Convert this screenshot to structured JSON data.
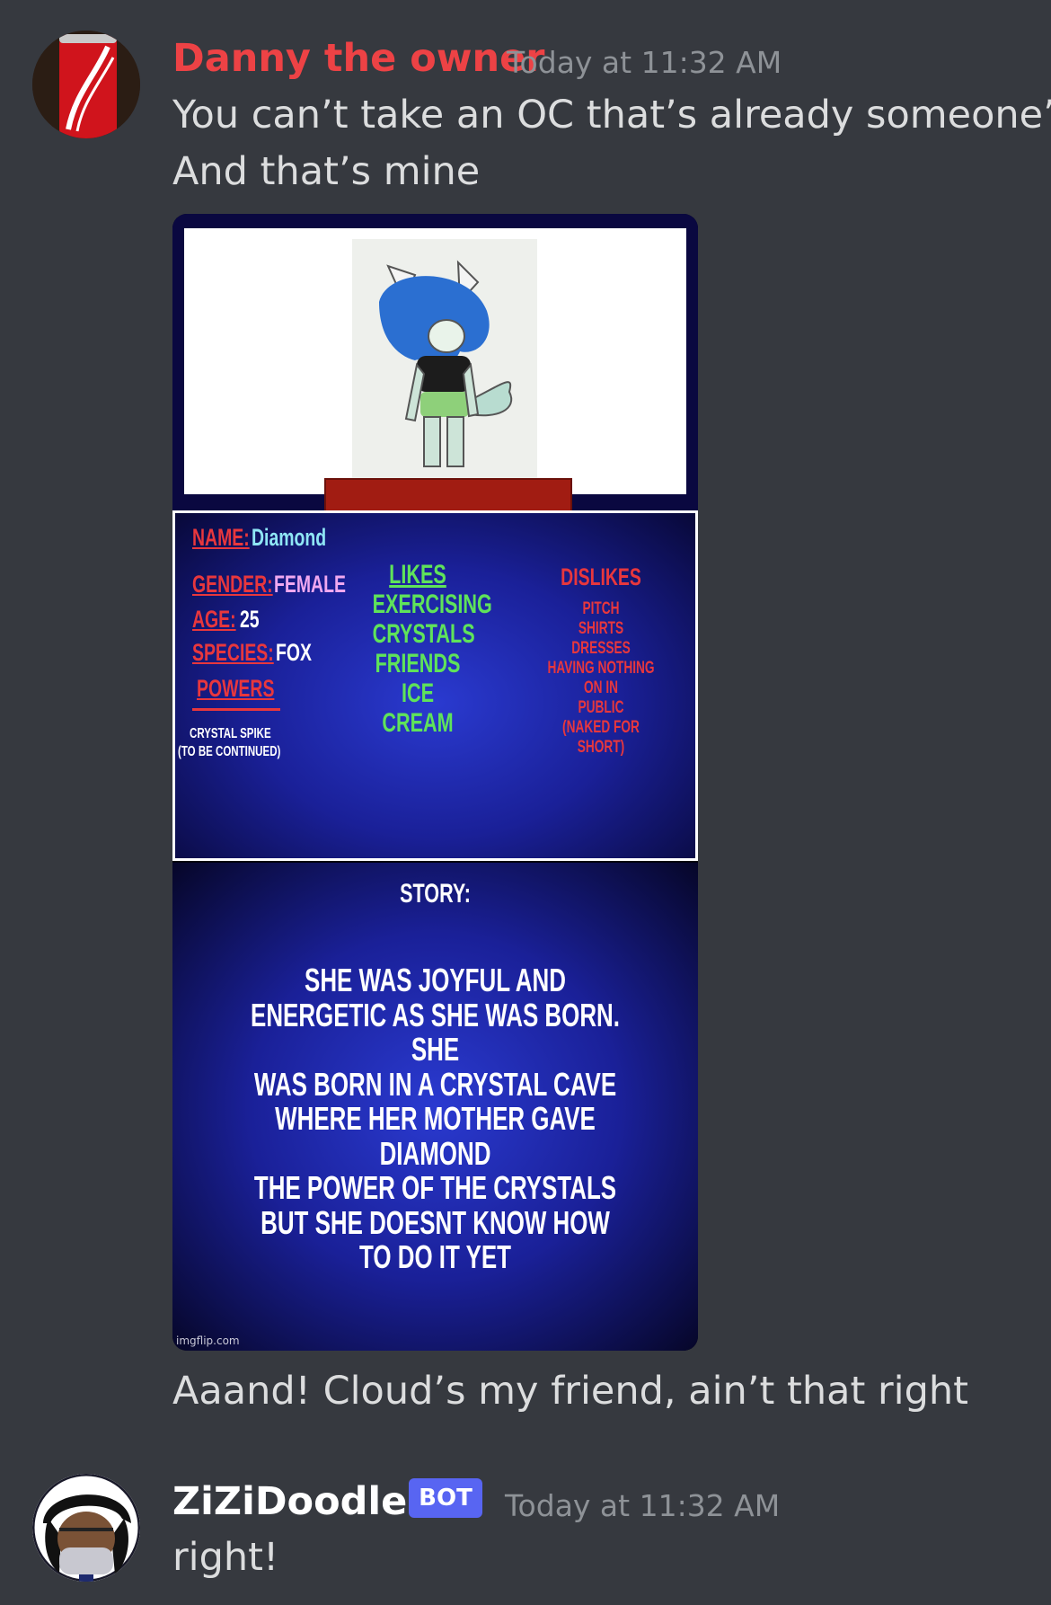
{
  "colors": {
    "owner_name": "#ed4245",
    "bot_name": "#ffffff",
    "bot_badge": "#5865f2",
    "background": "#36393f"
  },
  "message1": {
    "author": "Danny the owner",
    "timestamp": "Today at 11:32 AM",
    "lines": [
      "You can’t take an OC that’s already someone’s.",
      "And that’s mine"
    ],
    "attachment": {
      "name_label": "NAME:",
      "name_value": "Diamond",
      "gender_label": "GENDER:",
      "gender_value": "FEMALE",
      "age_label": "AGE:",
      "age_value": "25",
      "species_label": "SPECIES:",
      "species_value": "FOX",
      "powers_label": "POWERS",
      "powers_list": [
        "CRYSTAL SPIKE",
        "(TO BE CONTINUED)"
      ],
      "likes_label": "LIKES",
      "likes": [
        "EXERCISING",
        "CRYSTALS",
        "FRIENDS",
        "ICE CREAM"
      ],
      "dislikes_label": "DISLIKES",
      "dislikes": [
        "PITCH",
        "SHIRTS",
        "DRESSES",
        "HAVING NOTHING ON IN",
        "PUBLIC",
        "(NAKED FOR SHORT)"
      ],
      "story_label": "STORY:",
      "story_lines": [
        "SHE WAS JOYFUL AND",
        "ENERGETIC AS SHE WAS BORN. SHE",
        "WAS BORN IN A CRYSTAL CAVE",
        "WHERE HER MOTHER GAVE DIAMOND",
        "THE POWER OF THE CRYSTALS",
        "BUT SHE DOESNT KNOW HOW TO DO IT YET"
      ],
      "watermark": "imgflip.com"
    },
    "followup": "Aaand! Cloud’s my friend, ain’t that right"
  },
  "message2": {
    "author": "ZiZiDoodles",
    "badge": "BOT",
    "timestamp": "Today at 11:32 AM",
    "text": "right!"
  }
}
